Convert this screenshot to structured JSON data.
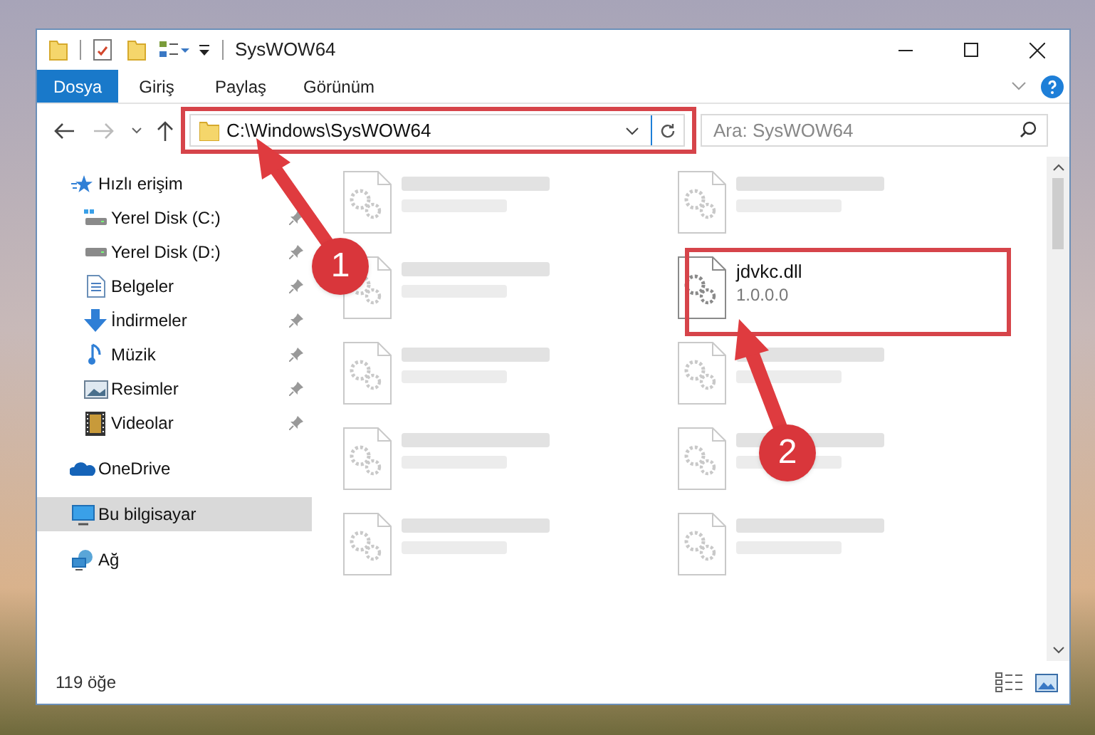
{
  "window": {
    "title": "SysWOW64"
  },
  "ribbon_tabs": [
    {
      "label": "Dosya",
      "selected": true
    },
    {
      "label": "Giriş",
      "selected": false
    },
    {
      "label": "Paylaş",
      "selected": false
    },
    {
      "label": "Görünüm",
      "selected": false
    }
  ],
  "address_bar": {
    "path": "C:\\Windows\\SysWOW64"
  },
  "search": {
    "placeholder": "Ara: SysWOW64"
  },
  "sidebar": {
    "items": [
      {
        "label": "Hızlı erişim",
        "selected": false,
        "children": [
          {
            "label": "Yerel Disk (C:)",
            "selected": false,
            "pinned": true
          },
          {
            "label": "Yerel Disk (D:)",
            "selected": false,
            "pinned": true
          },
          {
            "label": "Belgeler",
            "selected": false,
            "pinned": true
          },
          {
            "label": "İndirmeler",
            "selected": false,
            "pinned": true
          },
          {
            "label": "Müzik",
            "selected": false,
            "pinned": true
          },
          {
            "label": "Resimler",
            "selected": false,
            "pinned": true
          },
          {
            "label": "Videolar",
            "selected": false,
            "pinned": true
          }
        ]
      },
      {
        "label": "OneDrive",
        "selected": false
      },
      {
        "label": "Bu bilgisayar",
        "selected": true
      },
      {
        "label": "Ağ",
        "selected": false
      }
    ]
  },
  "files": [
    {
      "blurred": true
    },
    {
      "blurred": true
    },
    {
      "blurred": true
    },
    {
      "name": "jdvkc.dll",
      "detail": "1.0.0.0",
      "blurred": false
    },
    {
      "blurred": true
    },
    {
      "blurred": true
    },
    {
      "blurred": true
    },
    {
      "blurred": true
    },
    {
      "blurred": true
    },
    {
      "blurred": true
    }
  ],
  "status_bar": {
    "item_count": "119 öğe"
  },
  "annotations": [
    {
      "label": "1"
    },
    {
      "label": "2"
    }
  ]
}
